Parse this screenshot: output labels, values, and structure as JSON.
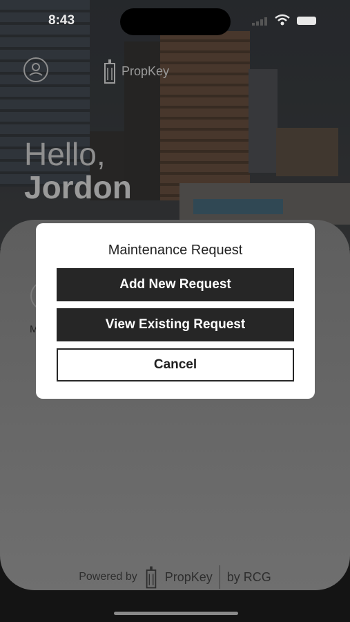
{
  "status_bar": {
    "time": "8:43",
    "icons": [
      "signal-icon",
      "wifi-icon",
      "battery-icon"
    ]
  },
  "header": {
    "profile_icon": "person-circle-icon",
    "logo_text": "PropKey"
  },
  "greeting": {
    "hello": "Hello,",
    "name": "Jordon"
  },
  "card": {
    "partial_label": "M"
  },
  "dialog": {
    "title": "Maintenance Request",
    "add_label": "Add New Request",
    "view_label": "View Existing Request",
    "cancel_label": "Cancel"
  },
  "footer": {
    "powered_label": "Powered by",
    "logo_text": "PropKey",
    "by_label": "by RCG"
  },
  "colors": {
    "button_dark": "#262626",
    "dialog_bg": "#ffffff",
    "overlay": "#5e5e5e"
  }
}
